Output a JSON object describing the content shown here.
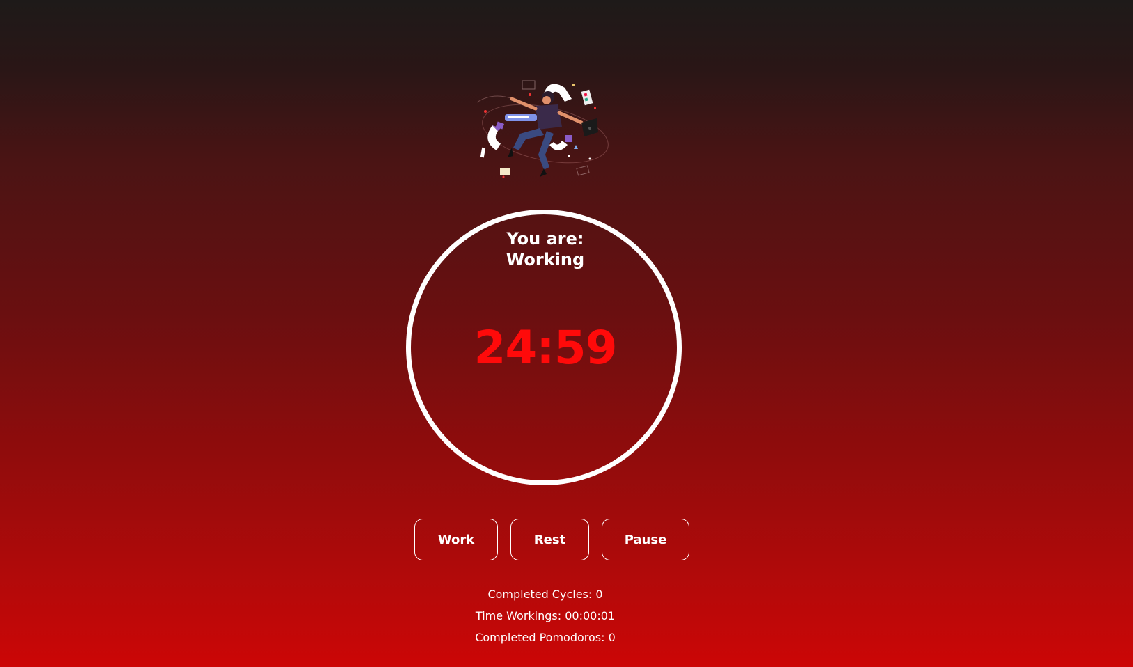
{
  "status": {
    "label": "You are:",
    "value": "Working"
  },
  "timer": {
    "display": "24:59"
  },
  "controls": {
    "work_label": "Work",
    "rest_label": "Rest",
    "pause_label": "Pause"
  },
  "stats": {
    "completed_cycles": "Completed Cycles: 0",
    "time_working": "Time Workings: 00:00:01",
    "completed_pomodoros": "Completed Pomodoros: 0"
  },
  "colors": {
    "timer_text": "#ff0a0a",
    "ring": "#ffffff",
    "accent_purple": "#8a5cc7"
  },
  "illustration": {
    "icon": "floating-person-with-magnets-illustration"
  }
}
